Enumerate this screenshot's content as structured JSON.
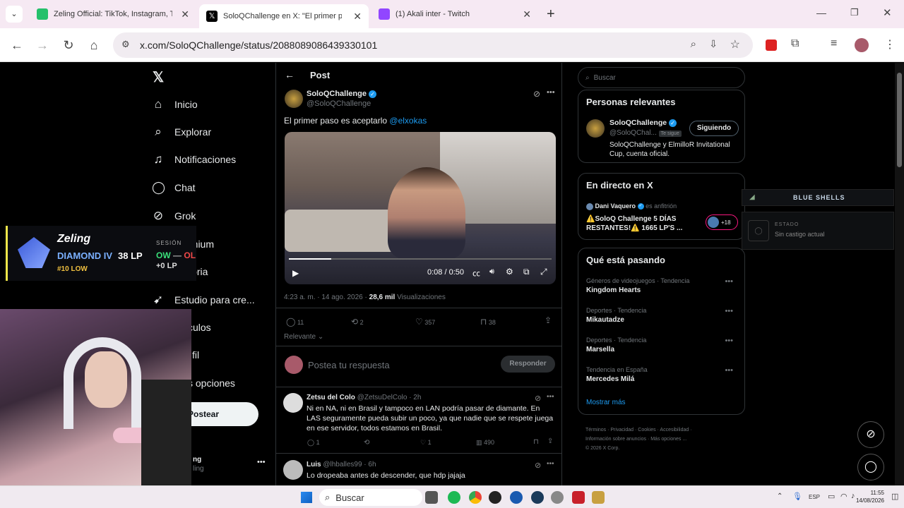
{
  "tabs": [
    {
      "title": "Zeling Official: TikTok, Instagram, Twitch, Twitter",
      "color": "#25c06b"
    },
    {
      "title": "SoloQChallenge en X: \"El primer paso es aceptar",
      "color": "#000000"
    },
    {
      "title": "(1) Akali inter - Twitch",
      "color": "#9146ff"
    }
  ],
  "url": "x.com/SoloQChallenge/status/2088089086439330101",
  "nav": {
    "items": [
      "Inicio",
      "Explorar",
      "Notificaciones",
      "Chat",
      "Grok",
      "Premium",
      "Historia",
      "Estudio para cre...",
      "culos",
      "fil",
      "s opciones"
    ],
    "post_button": "Postear",
    "account_name": "ng",
    "account_handle": "ling"
  },
  "post": {
    "header": "Post",
    "author": "SoloQChallenge",
    "handle": "@SoloQChallenge",
    "text": "El primer paso es aceptarlo ",
    "mention": "@elxokas",
    "video_time": "0:08 / 0:50",
    "video_progress": 0.16,
    "timestamp": "4:23 a. m. · 14 ago. 2026 · ",
    "views_count": "28,6 mil",
    "views_label": " Visualizaciones",
    "replies": "11",
    "reposts": "2",
    "likes": "357",
    "bookmarks": "38",
    "sort": "Relevante",
    "reply_placeholder": "Postea tu respuesta",
    "reply_button": "Responder"
  },
  "replies": [
    {
      "name": "Zetsu del Colo",
      "handle": "@ZetsuDelColo · 2h",
      "text": "Ni en NA, ni en Brasil y tampoco en LAN podría pasar de diamante. En LAS seguramente pueda subir un poco, ya que nadie que se respete juega en ese servidor, todos estamos en Brasil.",
      "replies": "1",
      "likes": "1",
      "views": "490"
    },
    {
      "name": "Luis",
      "handle": "@lhballes99 · 6h",
      "text": "Lo dropeaba antes de descender, que hdp jajaja"
    }
  ],
  "search_placeholder": "Buscar",
  "relevant": {
    "title": "Personas relevantes",
    "name": "SoloQChallenge",
    "handle": "@SoloQChal...",
    "follows_you": "Te sigue",
    "button": "Siguiendo",
    "bio": "SoloQChallenge y ElmilloR Invitational Cup, cuenta oficial."
  },
  "live": {
    "title": "En directo en X",
    "host": "Dani Vaquero",
    "host_role": "es anfitrión",
    "text": "⚠️SoloQ Challenge 5 DÍAS RESTANTES!⚠️ 1665 LP'S ...",
    "count": "+18"
  },
  "trends": {
    "title": "Qué está pasando",
    "items": [
      {
        "cat": "Géneros de videojuegos · Tendencia",
        "name": "Kingdom Hearts"
      },
      {
        "cat": "Deportes · Tendencia",
        "name": "Mikautadze"
      },
      {
        "cat": "Deportes · Tendencia",
        "name": "Marsella"
      },
      {
        "cat": "Tendencia en España",
        "name": "Mercedes Milá"
      }
    ],
    "more": "Mostrar más"
  },
  "footer": {
    "line1": "Términos · Privacidad · Cookies · Accesibilidad ·",
    "line2": "Información sobre anuncios · Más opciones ...",
    "line3": "© 2026 X Corp."
  },
  "overlay": {
    "name": "Zeling",
    "rank": "DIAMOND IV",
    "lp": "38 LP",
    "ladder": "#10 LOW",
    "session": "SESIÓN",
    "ow": "OW",
    "dash": "—",
    "ol": "OL",
    "zero_lp": "+0 LP"
  },
  "blueshells": {
    "title": "BLUE SHELLS",
    "estado": "ESTADO",
    "status": "Sin castigo actual"
  },
  "taskbar": {
    "search": "Buscar",
    "lang": "ESP",
    "time": "11:55",
    "date": "14/08/2026"
  }
}
